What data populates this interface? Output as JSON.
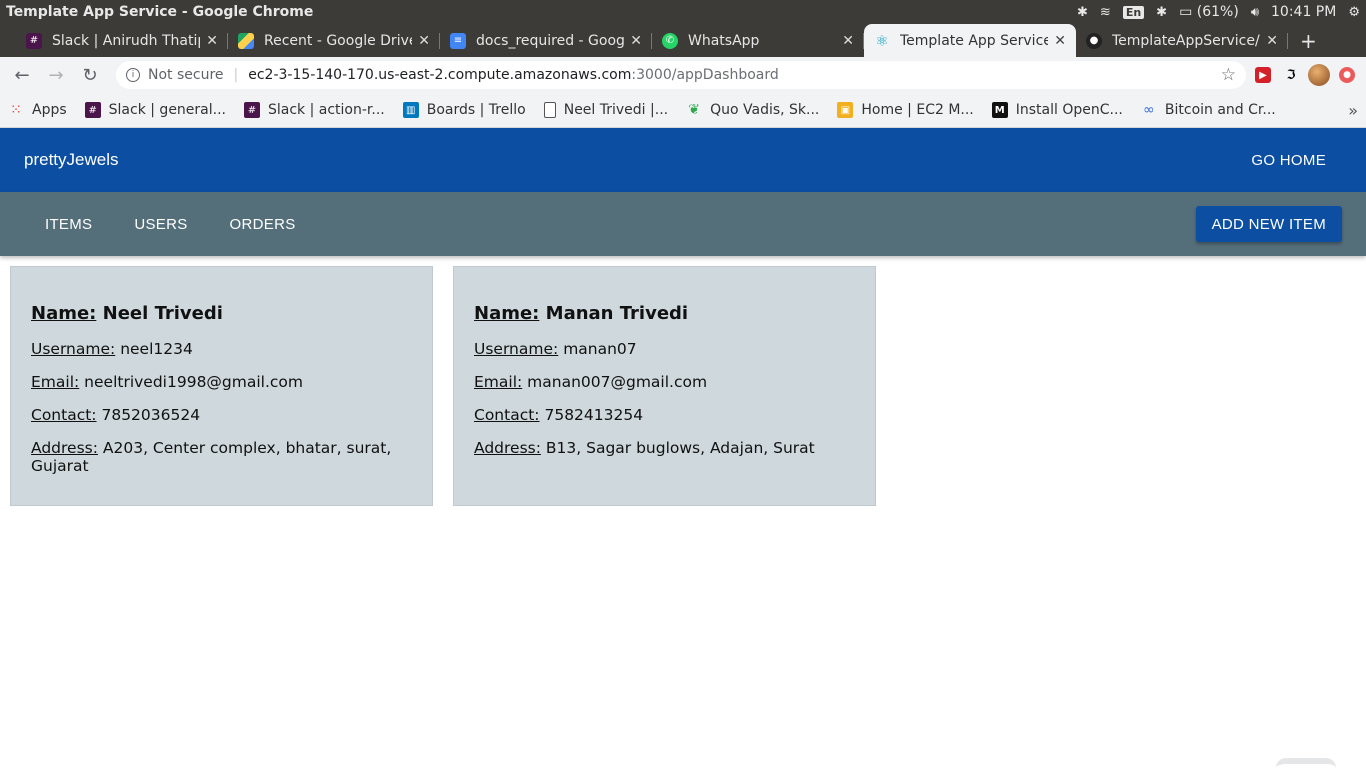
{
  "os": {
    "window_title": "Template App Service - Google Chrome",
    "lang": "En",
    "battery": "(61%)",
    "time": "10:41 PM"
  },
  "tabs": [
    {
      "title": "Slack | Anirudh Thatip",
      "icon": "slack-icon",
      "color": "#4a154b"
    },
    {
      "title": "Recent - Google Drive",
      "icon": "google-drive-icon",
      "color": "#1fa463"
    },
    {
      "title": "docs_required - Goog",
      "icon": "google-docs-icon",
      "color": "#4285f4"
    },
    {
      "title": "WhatsApp",
      "icon": "whatsapp-icon",
      "color": "#25d366"
    },
    {
      "title": "Template App Service",
      "icon": "react-icon",
      "color": "#61dafb",
      "active": true
    },
    {
      "title": "TemplateAppService/",
      "icon": "github-icon",
      "color": "#222222"
    }
  ],
  "address": {
    "not_secure": "Not secure",
    "url_host": "ec2-3-15-140-170.us-east-2.compute.amazonaws.com",
    "url_path": ":3000/appDashboard"
  },
  "bookmarks": [
    {
      "label": "Apps",
      "icon": "apps-grid-icon"
    },
    {
      "label": "Slack | general...",
      "icon": "slack-icon"
    },
    {
      "label": "Slack | action-r...",
      "icon": "slack-icon"
    },
    {
      "label": "Boards | Trello",
      "icon": "trello-icon"
    },
    {
      "label": "Neel Trivedi |...",
      "icon": "page-icon"
    },
    {
      "label": "Quo Vadis, Sk...",
      "icon": "leaf-icon"
    },
    {
      "label": "Home | EC2 M...",
      "icon": "box-icon"
    },
    {
      "label": "Install OpenC...",
      "icon": "medium-icon"
    },
    {
      "label": "Bitcoin and Cr...",
      "icon": "link-icon"
    }
  ],
  "app": {
    "brand": "prettyJewels",
    "go_home": "GO HOME",
    "nav": [
      "ITEMS",
      "USERS",
      "ORDERS"
    ],
    "add_new_item": "ADD NEW ITEM",
    "accent": "#0b4ea2",
    "subnav_color": "#546e7a",
    "card_color": "#cfd8dc"
  },
  "labels": {
    "name": "Name:",
    "username": "Username:",
    "email": "Email:",
    "contact": "Contact:",
    "address": "Address:"
  },
  "users": [
    {
      "name": "Neel Trivedi",
      "username": "neel1234",
      "email": "neeltrivedi1998@gmail.com",
      "contact": "7852036524",
      "address": "A203, Center complex, bhatar, surat, Gujarat"
    },
    {
      "name": "Manan Trivedi",
      "username": "manan07",
      "email": "manan007@gmail.com",
      "contact": "7582413254",
      "address": "B13, Sagar buglows, Adajan, Surat"
    }
  ]
}
